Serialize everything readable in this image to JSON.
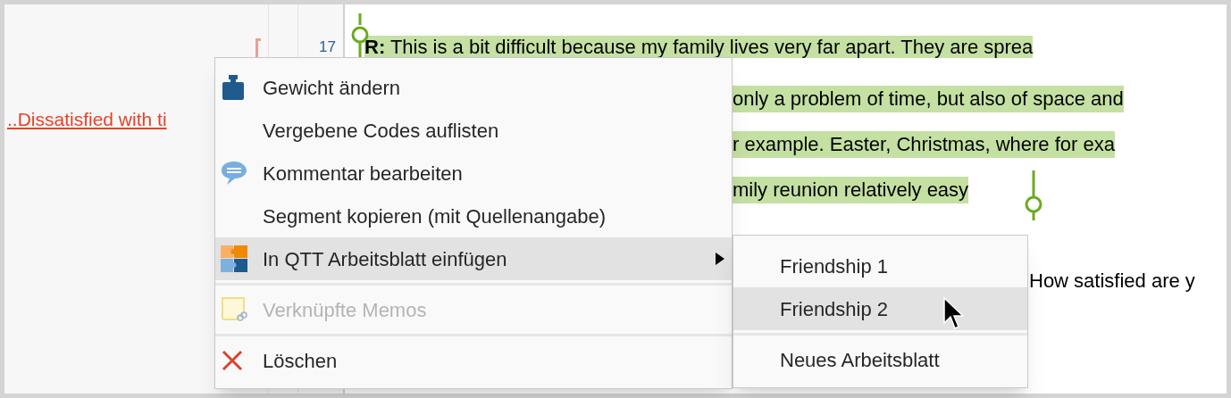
{
  "left_panel": {
    "code_label": "..Dissatisfied with ti"
  },
  "line_number": "17",
  "document": {
    "lines": [
      {
        "text": "**R:** This is a bit difficult because my family lives very far apart. They are sprea",
        "highlighted": true
      },
      {
        "text": "only a problem of time, but also of space and",
        "highlighted": true
      },
      {
        "text": "r example. Easter, Christmas, where for exa",
        "highlighted": true
      },
      {
        "text": "mily reunion relatively easy",
        "highlighted": true
      }
    ],
    "next_paragraph": "How satisfied are y"
  },
  "context_menu": {
    "items": [
      {
        "kind": "item",
        "label": "Gewicht ändern",
        "disabled": false,
        "selected": false,
        "submenu": false
      },
      {
        "kind": "item",
        "label": "Vergebene Codes auflisten",
        "disabled": false,
        "selected": false,
        "submenu": false
      },
      {
        "kind": "item",
        "label": "Kommentar bearbeiten",
        "disabled": false,
        "selected": false,
        "submenu": false
      },
      {
        "kind": "item",
        "label": "Segment kopieren (mit Quellenangabe)",
        "disabled": false,
        "selected": false,
        "submenu": false
      },
      {
        "kind": "item",
        "label": "In QTT Arbeitsblatt einfügen",
        "disabled": false,
        "selected": true,
        "submenu": true
      },
      {
        "kind": "separator"
      },
      {
        "kind": "item",
        "label": "Verknüpfte Memos",
        "disabled": true,
        "selected": false,
        "submenu": false
      },
      {
        "kind": "separator"
      },
      {
        "kind": "item",
        "label": "Löschen",
        "disabled": false,
        "selected": false,
        "submenu": false
      }
    ]
  },
  "submenu": {
    "items": [
      {
        "kind": "item",
        "label": "Friendship 1",
        "selected": false
      },
      {
        "kind": "item",
        "label": "Friendship 2",
        "selected": true
      },
      {
        "kind": "separator"
      },
      {
        "kind": "item",
        "label": "Neues Arbeitsblatt",
        "selected": false
      }
    ]
  }
}
